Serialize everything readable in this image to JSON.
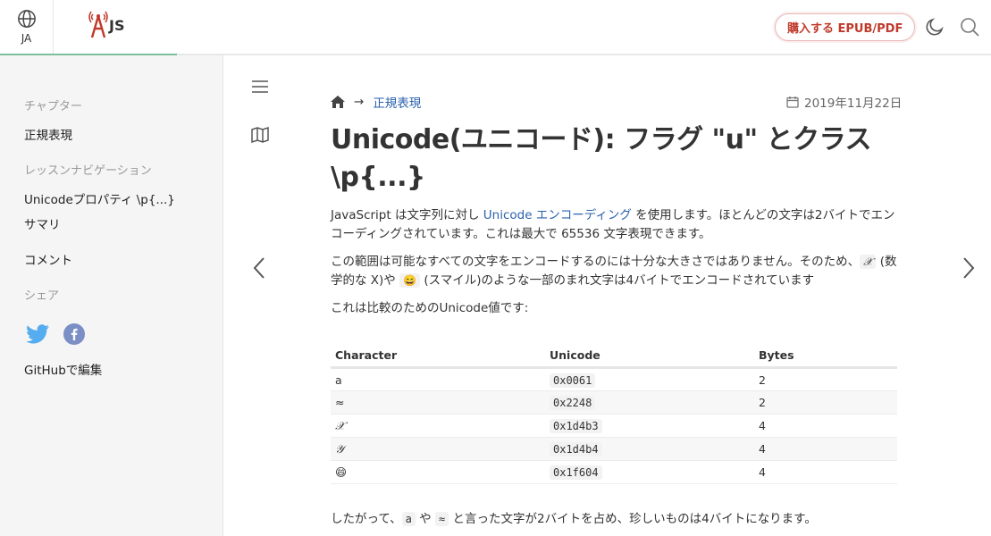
{
  "header": {
    "lang_code": "JA",
    "logo_text": "JS",
    "buy_label": "購入する EPUB/PDF"
  },
  "sidebar": {
    "chapter_title": "チャプター",
    "chapter_link": "正規表現",
    "lesson_nav_title": "レッスンナビゲーション",
    "lesson_links": [
      "Unicodeプロパティ \\p{...}",
      "サマリ"
    ],
    "comments": "コメント",
    "share_title": "シェア",
    "github_edit": "GitHubで編集"
  },
  "breadcrumb": {
    "arrow": "→",
    "link": "正規表現"
  },
  "date": "2019年11月22日",
  "title": "Unicode(ユニコード): フラグ \"u\" とクラス \\p{...}",
  "para1": {
    "before": "JavaScript は文字列に対し ",
    "link": "Unicode エンコーディング",
    "after": " を使用します。ほとんどの文字は2バイトでエンコーディングされています。これは最大で 65536 文字表現できます。"
  },
  "para2": {
    "before": "この範囲は可能なすべての文字をエンコードするのには十分な大きさではありません。そのため、",
    "math_x": "𝒳",
    "middle": " (数学的な X)や ",
    "emoji": "😄",
    "after": " (スマイル)のような一部のまれ文字は4バイトでエンコードされています"
  },
  "para3": "これは比較のためのUnicode値です:",
  "table": {
    "headers": [
      "Character",
      "Unicode",
      "Bytes"
    ],
    "rows": [
      {
        "char": "a",
        "code": "0x0061",
        "bytes": "2"
      },
      {
        "char": "≈",
        "code": "0x2248",
        "bytes": "2"
      },
      {
        "char": "𝒳",
        "code": "0x1d4b3",
        "bytes": "4"
      },
      {
        "char": "𝒴",
        "code": "0x1d4b4",
        "bytes": "4"
      },
      {
        "char": "😄",
        "code": "0x1f604",
        "bytes": "4"
      }
    ]
  },
  "para4": {
    "before": "したがって、",
    "code_a": "a",
    "mid1": " や ",
    "code_approx": "≈",
    "after": " と言った文字が2バイトを占め、珍しいものは4バイトになります。"
  },
  "colors": {
    "link": "#2b62ad",
    "buy_accent": "#c0392b",
    "progress": "#7fbf9a",
    "twitter": "#55acee",
    "facebook": "#7b8fc6"
  }
}
